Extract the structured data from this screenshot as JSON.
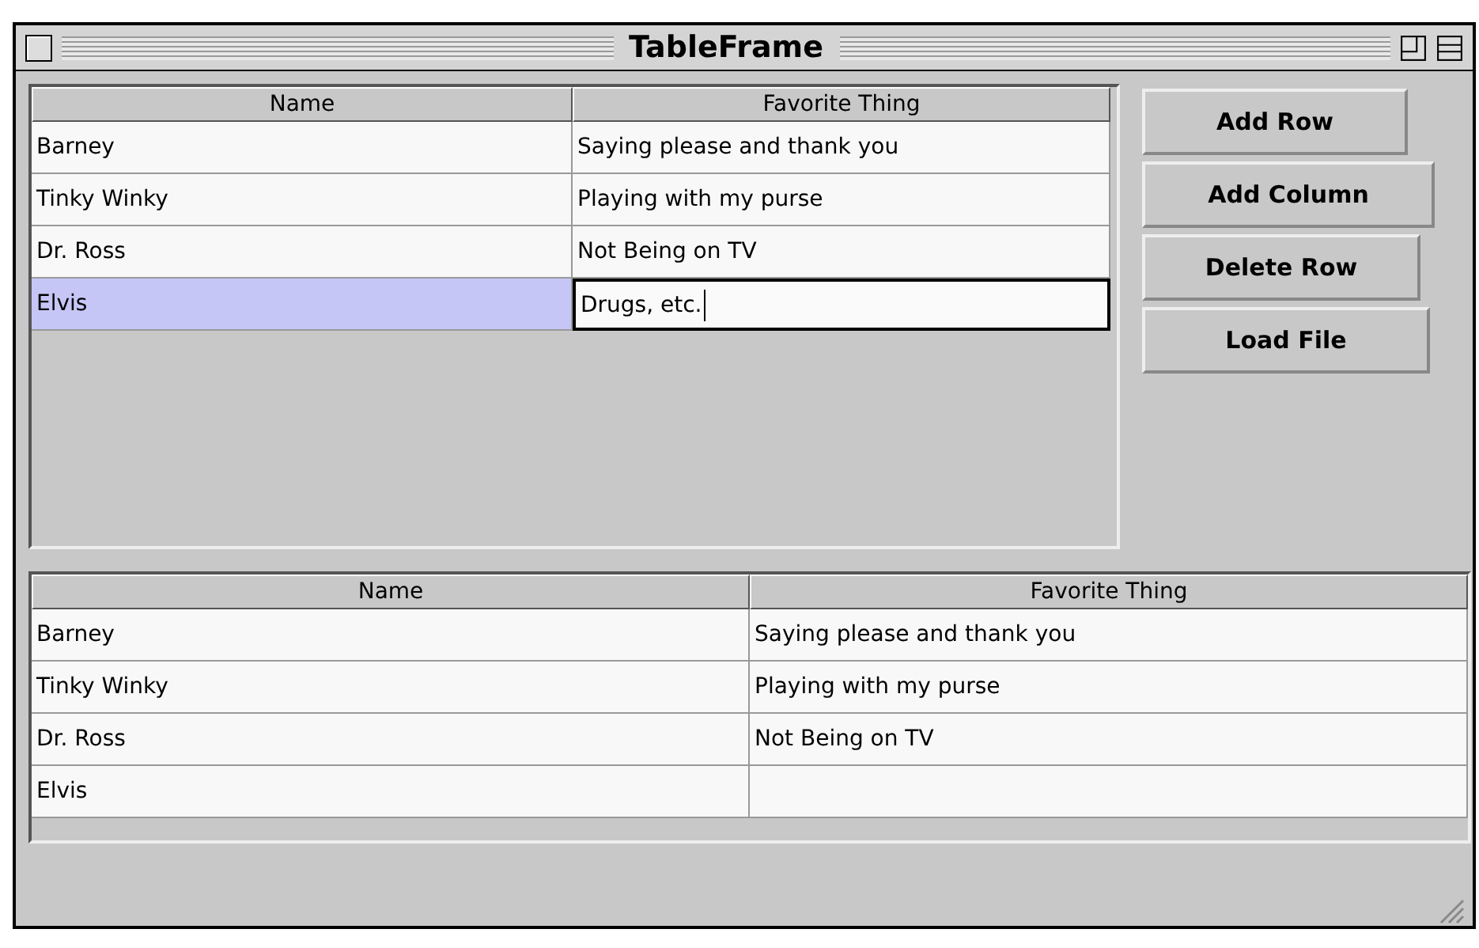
{
  "window": {
    "title": "TableFrame"
  },
  "top_table": {
    "columns": [
      "Name",
      "Favorite Thing"
    ],
    "rows": [
      {
        "name": "Barney",
        "favorite": "Saying please and thank you",
        "selected": false,
        "editing": false
      },
      {
        "name": "Tinky Winky",
        "favorite": "Playing with my purse",
        "selected": false,
        "editing": false
      },
      {
        "name": "Dr. Ross",
        "favorite": "Not Being on TV",
        "selected": false,
        "editing": false
      },
      {
        "name": "Elvis",
        "favorite": "Drugs, etc.",
        "selected": true,
        "editing": true
      }
    ]
  },
  "buttons": [
    {
      "label": "Add Row"
    },
    {
      "label": "Add Column"
    },
    {
      "label": "Delete Row"
    },
    {
      "label": "Load File"
    }
  ],
  "bottom_table": {
    "columns": [
      "Name",
      "Favorite Thing"
    ],
    "rows": [
      {
        "name": "Barney",
        "favorite": "Saying please and thank you"
      },
      {
        "name": "Tinky Winky",
        "favorite": "Playing with my purse"
      },
      {
        "name": "Dr. Ross",
        "favorite": "Not Being on TV"
      },
      {
        "name": "Elvis"
      }
    ]
  }
}
